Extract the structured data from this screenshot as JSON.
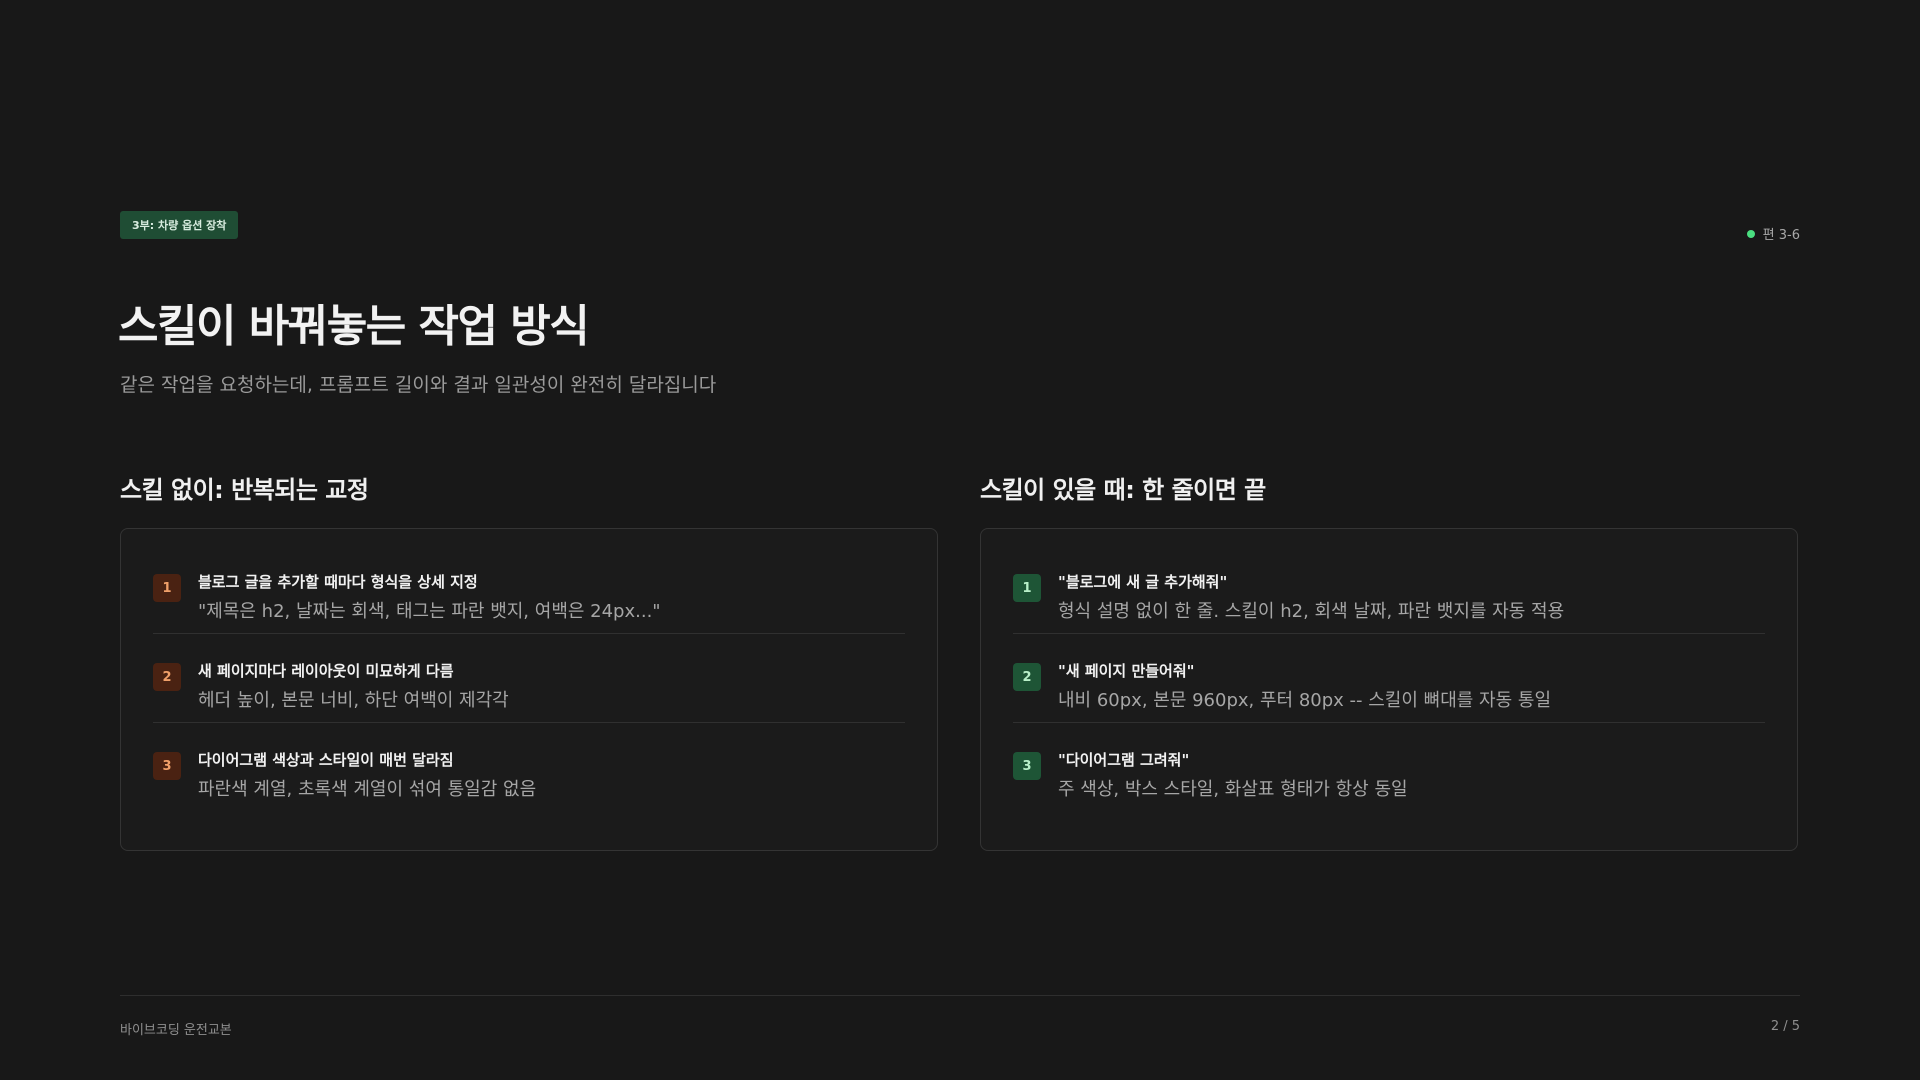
{
  "badge": "3부: 차량 옵션 장착",
  "episode": "편 3-6",
  "colors": {
    "background": "#181818",
    "accent_green": "#4ade80",
    "badge_bg": "#1f4d34",
    "without_num_bg": "#4a2212",
    "with_num_bg": "#1e5536"
  },
  "title": "스킬이 바꿔놓는 작업 방식",
  "subtitle": "같은 작업을 요청하는데, 프롬프트 길이와 결과 일관성이 완전히 달라집니다",
  "without_skill": {
    "heading": "스킬 없이: 반복되는 교정",
    "items": [
      {
        "num": "1",
        "title": "블로그 글을 추가할 때마다 형식을 상세 지정",
        "desc": "\"제목은 h2, 날짜는 회색, 태그는 파란 뱃지, 여백은 24px...\""
      },
      {
        "num": "2",
        "title": "새 페이지마다 레이아웃이 미묘하게 다름",
        "desc": "헤더 높이, 본문 너비, 하단 여백이 제각각"
      },
      {
        "num": "3",
        "title": "다이어그램 색상과 스타일이 매번 달라짐",
        "desc": "파란색 계열, 초록색 계열이 섞여 통일감 없음"
      }
    ]
  },
  "with_skill": {
    "heading": "스킬이 있을 때: 한 줄이면 끝",
    "items": [
      {
        "num": "1",
        "title": "\"블로그에 새 글 추가해줘\"",
        "desc": "형식 설명 없이 한 줄. 스킬이 h2, 회색 날짜, 파란 뱃지를 자동 적용"
      },
      {
        "num": "2",
        "title": "\"새 페이지 만들어줘\"",
        "desc": "내비 60px, 본문 960px, 푸터 80px -- 스킬이 뼈대를 자동 통일"
      },
      {
        "num": "3",
        "title": "\"다이어그램 그려줘\"",
        "desc": "주 색상, 박스 스타일, 화살표 형태가 항상 동일"
      }
    ]
  },
  "footer": {
    "left": "바이브코딩 운전교본",
    "page": "2 / 5"
  }
}
